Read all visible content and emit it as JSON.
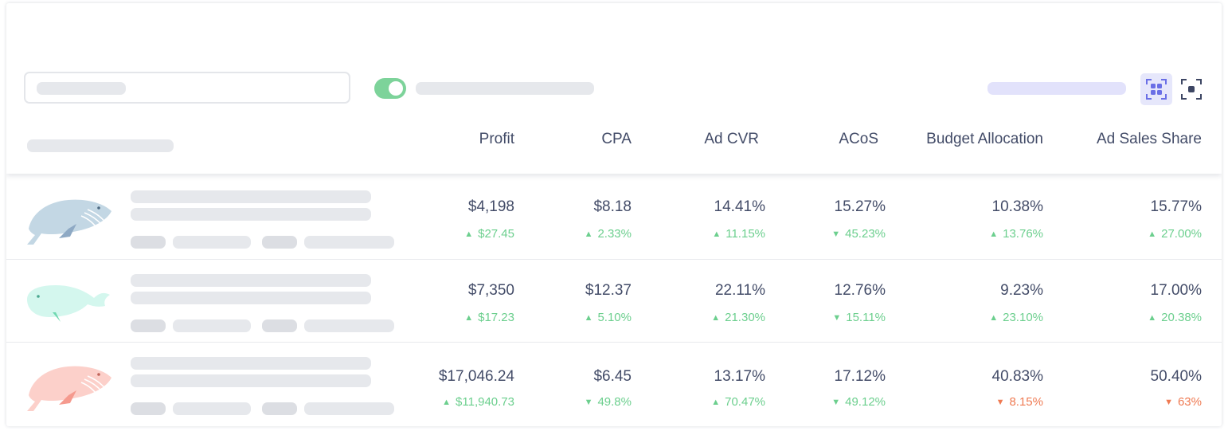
{
  "colors": {
    "positive": "#6ccf8e",
    "negative": "#ef7a52",
    "toggle_on": "#7dd39a",
    "accent": "#6a6fe6"
  },
  "toolbar": {
    "toggle_state": "on",
    "view_icons": [
      "grid-view-icon",
      "fullscreen-icon"
    ]
  },
  "columns": [
    "Profit",
    "CPA",
    "Ad CVR",
    "ACoS",
    "Budget Allocation",
    "Ad Sales Share"
  ],
  "rows": [
    {
      "image": "whale-blue",
      "cells": [
        {
          "value": "$4,198",
          "delta": "$27.45",
          "dir": "up",
          "tone": "positive"
        },
        {
          "value": "$8.18",
          "delta": "2.33%",
          "dir": "up",
          "tone": "positive"
        },
        {
          "value": "14.41%",
          "delta": "11.15%",
          "dir": "up",
          "tone": "positive"
        },
        {
          "value": "15.27%",
          "delta": "45.23%",
          "dir": "down",
          "tone": "positive"
        },
        {
          "value": "10.38%",
          "delta": "13.76%",
          "dir": "up",
          "tone": "positive"
        },
        {
          "value": "15.77%",
          "delta": "27.00%",
          "dir": "up",
          "tone": "positive"
        }
      ]
    },
    {
      "image": "whale-mint",
      "cells": [
        {
          "value": "$7,350",
          "delta": "$17.23",
          "dir": "up",
          "tone": "positive"
        },
        {
          "value": "$12.37",
          "delta": "5.10%",
          "dir": "up",
          "tone": "positive"
        },
        {
          "value": "22.11%",
          "delta": "21.30%",
          "dir": "up",
          "tone": "positive"
        },
        {
          "value": "12.76%",
          "delta": "15.11%",
          "dir": "down",
          "tone": "positive"
        },
        {
          "value": "9.23%",
          "delta": "23.10%",
          "dir": "up",
          "tone": "positive"
        },
        {
          "value": "17.00%",
          "delta": "20.38%",
          "dir": "up",
          "tone": "positive"
        }
      ]
    },
    {
      "image": "whale-pink",
      "cells": [
        {
          "value": "$17,046.24",
          "delta": "$11,940.73",
          "dir": "up",
          "tone": "positive"
        },
        {
          "value": "$6.45",
          "delta": "49.8%",
          "dir": "down",
          "tone": "positive"
        },
        {
          "value": "13.17%",
          "delta": "70.47%",
          "dir": "up",
          "tone": "positive"
        },
        {
          "value": "17.12%",
          "delta": "49.12%",
          "dir": "down",
          "tone": "positive"
        },
        {
          "value": "40.83%",
          "delta": "8.15%",
          "dir": "down",
          "tone": "negative"
        },
        {
          "value": "50.40%",
          "delta": "63%",
          "dir": "down",
          "tone": "negative"
        }
      ]
    }
  ]
}
